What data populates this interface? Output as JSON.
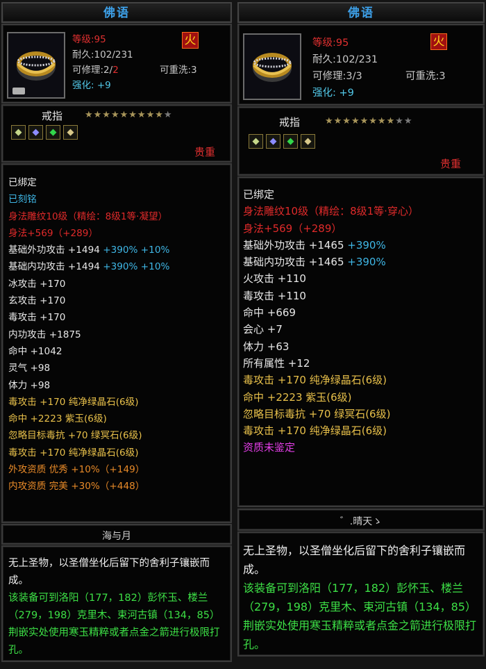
{
  "left": {
    "title": "佛语",
    "level_label": "等级:95",
    "durability_label": "耐久:102/231",
    "repair_prefix": "可修理:2/",
    "repair_suffix": "2",
    "rewash_label": "可重洗:3",
    "enhance_label": "强化: +9",
    "item_name": "戒指",
    "stars_on": "★★★★★★★★★",
    "stars_off": "★",
    "rarity": "贵重",
    "attrs": [
      {
        "parts": [
          {
            "t": "已绑定",
            "c": "white"
          }
        ]
      },
      {
        "parts": [
          {
            "t": "已刻铭",
            "c": "cyan"
          }
        ]
      },
      {
        "parts": [
          {
            "t": "身法雕纹10级（精绘：8级1等·凝望）",
            "c": "red"
          }
        ]
      },
      {
        "parts": [
          {
            "t": "身法+569（+289）",
            "c": "red"
          }
        ]
      },
      {
        "parts": [
          {
            "t": "基础外功攻击 +1494 ",
            "c": "white"
          },
          {
            "t": "+390% +10%",
            "c": "cyan"
          }
        ]
      },
      {
        "parts": [
          {
            "t": "基础内功攻击 +1494 ",
            "c": "white"
          },
          {
            "t": "+390% +10%",
            "c": "cyan"
          }
        ]
      },
      {
        "parts": [
          {
            "t": "冰攻击 +170",
            "c": "white"
          }
        ]
      },
      {
        "parts": [
          {
            "t": "玄攻击 +170",
            "c": "white"
          }
        ]
      },
      {
        "parts": [
          {
            "t": "毒攻击 +170",
            "c": "white"
          }
        ]
      },
      {
        "parts": [
          {
            "t": "内功攻击 +1875",
            "c": "white"
          }
        ]
      },
      {
        "parts": [
          {
            "t": "命中 +1042",
            "c": "white"
          }
        ]
      },
      {
        "parts": [
          {
            "t": "灵气 +98",
            "c": "white"
          }
        ]
      },
      {
        "parts": [
          {
            "t": "体力 +98",
            "c": "white"
          }
        ]
      },
      {
        "parts": [
          {
            "t": "毒攻击 +170 纯净绿晶石(6级)",
            "c": "gold"
          }
        ]
      },
      {
        "parts": [
          {
            "t": "命中 +2223 紫玉(6级)",
            "c": "gold"
          }
        ]
      },
      {
        "parts": [
          {
            "t": "忽略目标毒抗 +70 绿冥石(6级)",
            "c": "gold"
          }
        ]
      },
      {
        "parts": [
          {
            "t": "毒攻击 +170 纯净绿晶石(6级)",
            "c": "gold"
          }
        ]
      },
      {
        "parts": [
          {
            "t": "外攻资质  优秀 +10%（+149）",
            "c": "orange"
          }
        ]
      },
      {
        "parts": [
          {
            "t": "内攻资质  完美 +30%（+448）",
            "c": "orange"
          }
        ]
      }
    ],
    "owner": "海与月",
    "desc_white": "无上圣物，以圣僧坐化后留下的舍利子镶嵌而成。",
    "desc_green": "该装备可到洛阳（177，182）彭怀玉、楼兰（279，198）克里木、束河古镇（134，85）荆嵌实处使用寒玉精粹或者点金之箭进行极限打孔。"
  },
  "right": {
    "title": "佛语",
    "level_label": "等级:95",
    "durability_label": "耐久:102/231",
    "repair_label": "可修理:3/3",
    "rewash_label": "可重洗:3",
    "enhance_label": "强化: +9",
    "item_name": "戒指",
    "stars_on": "★★★★★★★★",
    "stars_off": "★★",
    "rarity": "贵重",
    "attrs": [
      {
        "parts": [
          {
            "t": "已绑定",
            "c": "white"
          }
        ]
      },
      {
        "parts": [
          {
            "t": "身法雕纹10级（精绘：8级1等·穿心）",
            "c": "red"
          }
        ]
      },
      {
        "parts": [
          {
            "t": "身法+569（+289）",
            "c": "red"
          }
        ]
      },
      {
        "parts": [
          {
            "t": "基础外功攻击 +1465 ",
            "c": "white"
          },
          {
            "t": "+390%",
            "c": "cyan"
          }
        ]
      },
      {
        "parts": [
          {
            "t": "基础内功攻击 +1465 ",
            "c": "white"
          },
          {
            "t": "+390%",
            "c": "cyan"
          }
        ]
      },
      {
        "parts": [
          {
            "t": "火攻击 +110",
            "c": "white"
          }
        ]
      },
      {
        "parts": [
          {
            "t": "毒攻击 +110",
            "c": "white"
          }
        ]
      },
      {
        "parts": [
          {
            "t": "命中 +669",
            "c": "white"
          }
        ]
      },
      {
        "parts": [
          {
            "t": "会心 +7",
            "c": "white"
          }
        ]
      },
      {
        "parts": [
          {
            "t": "体力 +63",
            "c": "white"
          }
        ]
      },
      {
        "parts": [
          {
            "t": "所有属性 +12",
            "c": "white"
          }
        ]
      },
      {
        "parts": [
          {
            "t": "毒攻击 +170 纯净绿晶石(6级)",
            "c": "gold"
          }
        ]
      },
      {
        "parts": [
          {
            "t": "命中 +2223 紫玉(6级)",
            "c": "gold"
          }
        ]
      },
      {
        "parts": [
          {
            "t": "忽略目标毒抗 +70 绿冥石(6级)",
            "c": "gold"
          }
        ]
      },
      {
        "parts": [
          {
            "t": "毒攻击 +170 纯净绿晶石(6级)",
            "c": "gold"
          }
        ]
      },
      {
        "parts": [
          {
            "t": "资质未鉴定",
            "c": "pink"
          }
        ]
      }
    ],
    "owner": "゛.晴天ゝ",
    "desc_white": "无上圣物，以圣僧坐化后留下的舍利子镶嵌而成。",
    "desc_green": "该装备可到洛阳（177，182）彭怀玉、楼兰（279，198）克里木、束河古镇（134，85）荆嵌实处使用寒玉精粹或者点金之箭进行极限打孔。"
  }
}
